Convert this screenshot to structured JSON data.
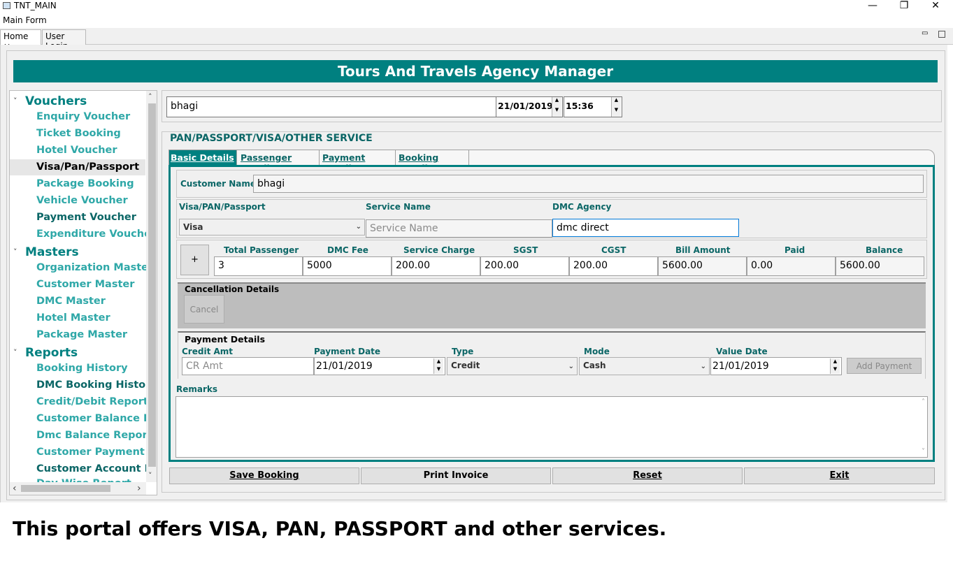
{
  "window": {
    "title": "TNT_MAIN",
    "minimize": "—",
    "restore": "❐",
    "close": "✕"
  },
  "menu": {
    "main_form": "Main Form"
  },
  "doc_tabs": [
    {
      "label": "Home ⨯",
      "active": true
    },
    {
      "label": "User Login",
      "active": false
    }
  ],
  "doc_tab_controls": {
    "minimize": "▭",
    "maximize": "▭"
  },
  "banner": {
    "title": "Tours And Travels Agency Manager"
  },
  "sidebar": {
    "groups": [
      {
        "label": "Vouchers",
        "twisty": "˅",
        "items": [
          "Enquiry Voucher",
          "Ticket Booking",
          "Hotel Voucher",
          "Visa/Pan/Passport",
          "Package Booking",
          "Vehicle Voucher",
          "Payment Voucher",
          "Expenditure Voucher"
        ]
      },
      {
        "label": "Masters",
        "twisty": "˅",
        "items": [
          "Organization Master",
          "Customer Master",
          "DMC Master",
          "Hotel Master",
          "Package Master"
        ]
      },
      {
        "label": "Reports",
        "twisty": "˅",
        "items": [
          "Booking History",
          "DMC Booking History",
          "Credit/Debit Report",
          "Customer Balance Report",
          "Dmc Balance Report",
          "Customer Payment Report",
          "Customer Account Report",
          "Day Wise Report"
        ]
      }
    ],
    "selected_item": "Visa/Pan/Passport",
    "scroll": {
      "up": "˄",
      "down": "˅",
      "left": "‹",
      "right": "›"
    }
  },
  "top_row": {
    "customer_value": "bhagi",
    "date_value": "21/01/2019",
    "time_value": "15:36",
    "spin_up": "▲",
    "spin_down": "▼"
  },
  "service_panel": {
    "title": "PAN/PASSPORT/VISA/OTHER SERVICE",
    "tabs": [
      "Basic Details",
      "Passenger Details",
      "Payment Details",
      "Booking Details"
    ],
    "active_tab": "Basic Details"
  },
  "basic": {
    "customer_name_label": "Customer Name",
    "customer_name_value": "bhagi",
    "visa_label": "Visa/PAN/Passport",
    "visa_value": "Visa",
    "service_name_label": "Service Name",
    "service_name_placeholder": "Service Name",
    "dmc_agency_label": "DMC Agency",
    "dmc_agency_value": "dmc direct",
    "chevron": "⌄"
  },
  "fees": {
    "add_button": "+",
    "headers": [
      "Total Passenger",
      "DMC Fee",
      "Service Charge",
      "SGST",
      "CGST",
      "Bill Amount",
      "Paid",
      "Balance"
    ],
    "values": [
      "3",
      "5000",
      "200.00",
      "200.00",
      "200.00",
      "5600.00",
      "0.00",
      "5600.00"
    ]
  },
  "cancellation": {
    "title": "Cancellation Details",
    "cancel_button": "Cancel"
  },
  "payment": {
    "title": "Payment Details",
    "credit_label": "Credit Amt",
    "credit_placeholder": "CR  Amt",
    "payment_date_label": "Payment Date",
    "payment_date_value": "21/01/2019",
    "type_label": "Type",
    "type_value": "Credit",
    "mode_label": "Mode",
    "mode_value": "Cash",
    "value_date_label": "Value Date",
    "value_date_value": "21/01/2019",
    "add_payment_button": "Add Payment"
  },
  "remarks": {
    "label": "Remarks",
    "value": ""
  },
  "actions": {
    "save": "Save Booking",
    "print": "Print Invoice",
    "reset": "Reset",
    "exit": "Exit"
  },
  "caption": "This portal offers VISA, PAN, PASSPORT and other services.",
  "colors": {
    "accent": "#008080",
    "label": "#0b6666",
    "tree_item": "#2fa8a8"
  }
}
